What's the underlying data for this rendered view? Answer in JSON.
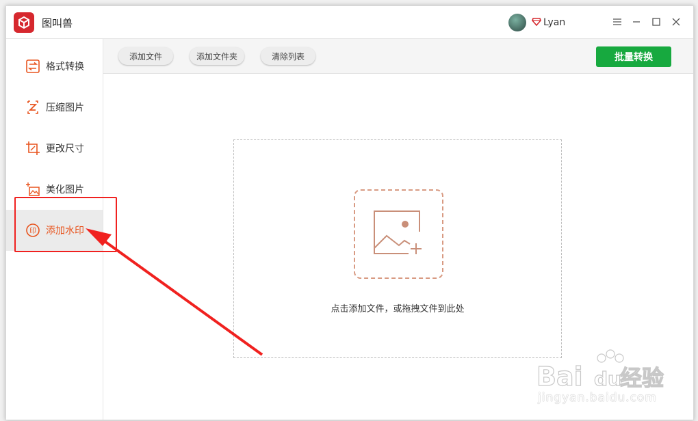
{
  "app": {
    "title": "图叫兽",
    "username": "Lyan"
  },
  "sidebar": {
    "items": [
      {
        "label": "格式转换"
      },
      {
        "label": "压缩图片"
      },
      {
        "label": "更改尺寸"
      },
      {
        "label": "美化图片"
      },
      {
        "label": "添加水印"
      }
    ],
    "active_index": 4
  },
  "toolbar": {
    "add_file": "添加文件",
    "add_folder": "添加文件夹",
    "clear_list": "清除列表",
    "batch_convert": "批量转换"
  },
  "dropzone": {
    "hint": "点击添加文件，或拖拽文件到此处"
  },
  "colors": {
    "accent": "#e8541e",
    "primary": "#17a93f",
    "annotation": "#f0211f"
  },
  "watermark": {
    "brand": "Bai",
    "brand_du": "du",
    "brand_cn": "经验",
    "url": "jingyan.baidu.com"
  }
}
